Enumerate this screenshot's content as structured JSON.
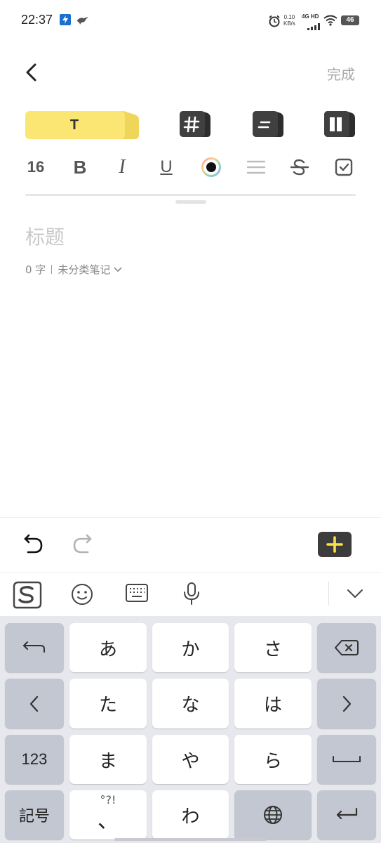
{
  "status_bar": {
    "time": "22:37",
    "net_speed_value": "0.10",
    "net_speed_unit": "KB/s",
    "network": "4G HD",
    "battery": "46"
  },
  "header": {
    "back_icon": "chevron-left-icon",
    "done_label": "完成"
  },
  "style_tabs": [
    {
      "name": "text-style",
      "label": "T",
      "selected": true,
      "color": "#fbe673"
    },
    {
      "name": "heading-style",
      "icon": "hash-icon",
      "selected": false
    },
    {
      "name": "list-style",
      "icon": "align-icon",
      "selected": false
    },
    {
      "name": "layout-style",
      "icon": "columns-icon",
      "selected": false
    }
  ],
  "format_bar": {
    "font_size": "16",
    "bold": "B",
    "italic": "I",
    "underline": "U",
    "color_icon": "color-picker-icon",
    "align_icon": "align-icon",
    "strike_icon": "strikethrough-icon",
    "checkbox_icon": "checkbox-icon"
  },
  "note": {
    "title_placeholder": "标题",
    "word_count": "0 字",
    "category": "未分类笔记"
  },
  "editor_toolbar": {
    "undo_icon": "undo-icon",
    "redo_icon": "redo-icon",
    "add_icon": "plus-icon",
    "add_color": "#fbe04a"
  },
  "keyboard_toolbar": {
    "icons": [
      "sogou-logo-icon",
      "emoji-icon",
      "keyboard-icon",
      "microphone-icon",
      "chevron-down-icon"
    ]
  },
  "keyboard": {
    "row1": {
      "left": "undo-arrow-icon",
      "keys": [
        "あ",
        "か",
        "さ"
      ],
      "right": "backspace-icon"
    },
    "row2": {
      "left": "chevron-left-icon",
      "keys": [
        "た",
        "な",
        "は"
      ],
      "right": "chevron-right-icon"
    },
    "row3": {
      "left": "123",
      "keys": [
        "ま",
        "や",
        "ら"
      ],
      "right": "space-icon"
    },
    "row4": {
      "left": "記号",
      "punct_top": "°?!",
      "punct_bottom": "、",
      "key_wa": "わ",
      "globe": "globe-icon",
      "right": "enter-icon"
    }
  }
}
